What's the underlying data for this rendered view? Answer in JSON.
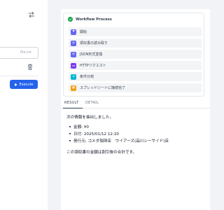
{
  "left_panel": {
    "file_input_placeholder": "file.txt",
    "execute_label": "Execute"
  },
  "workflow": {
    "title": "Workflow Process",
    "steps": [
      {
        "label": "開始",
        "icon": "flag-icon",
        "color": "#6366f1"
      },
      {
        "label": "領収書の読み取り",
        "icon": "document-scan-icon",
        "color": "#6366f1"
      },
      {
        "label": "JSON形式変換",
        "icon": "code-icon",
        "color": "#6366f1"
      },
      {
        "label": "HTTPリクエスト",
        "icon": "api-icon",
        "color": "#7c3aed"
      },
      {
        "label": "条件分岐",
        "icon": "branch-icon",
        "color": "#06b6d4"
      },
      {
        "label": "スプレッドシートに接続完了",
        "icon": "sheet-icon",
        "color": "#f59e0b"
      }
    ]
  },
  "tabs": {
    "result": "RESULT",
    "detail": "DETAIL"
  },
  "result": {
    "intro": "次の情報を抽出しました。",
    "items": [
      "金額: ¥0",
      "日付: 2025/01/12 12:20",
      "発行元: コメダ珈琲店　ワイアーズ(品川シーサイド)店"
    ],
    "summary": "この領収書の金額は割引後の合計です。"
  },
  "colors": {
    "accent": "#2563eb",
    "success": "#16a34a",
    "step_bg": "#f3f4f6"
  }
}
